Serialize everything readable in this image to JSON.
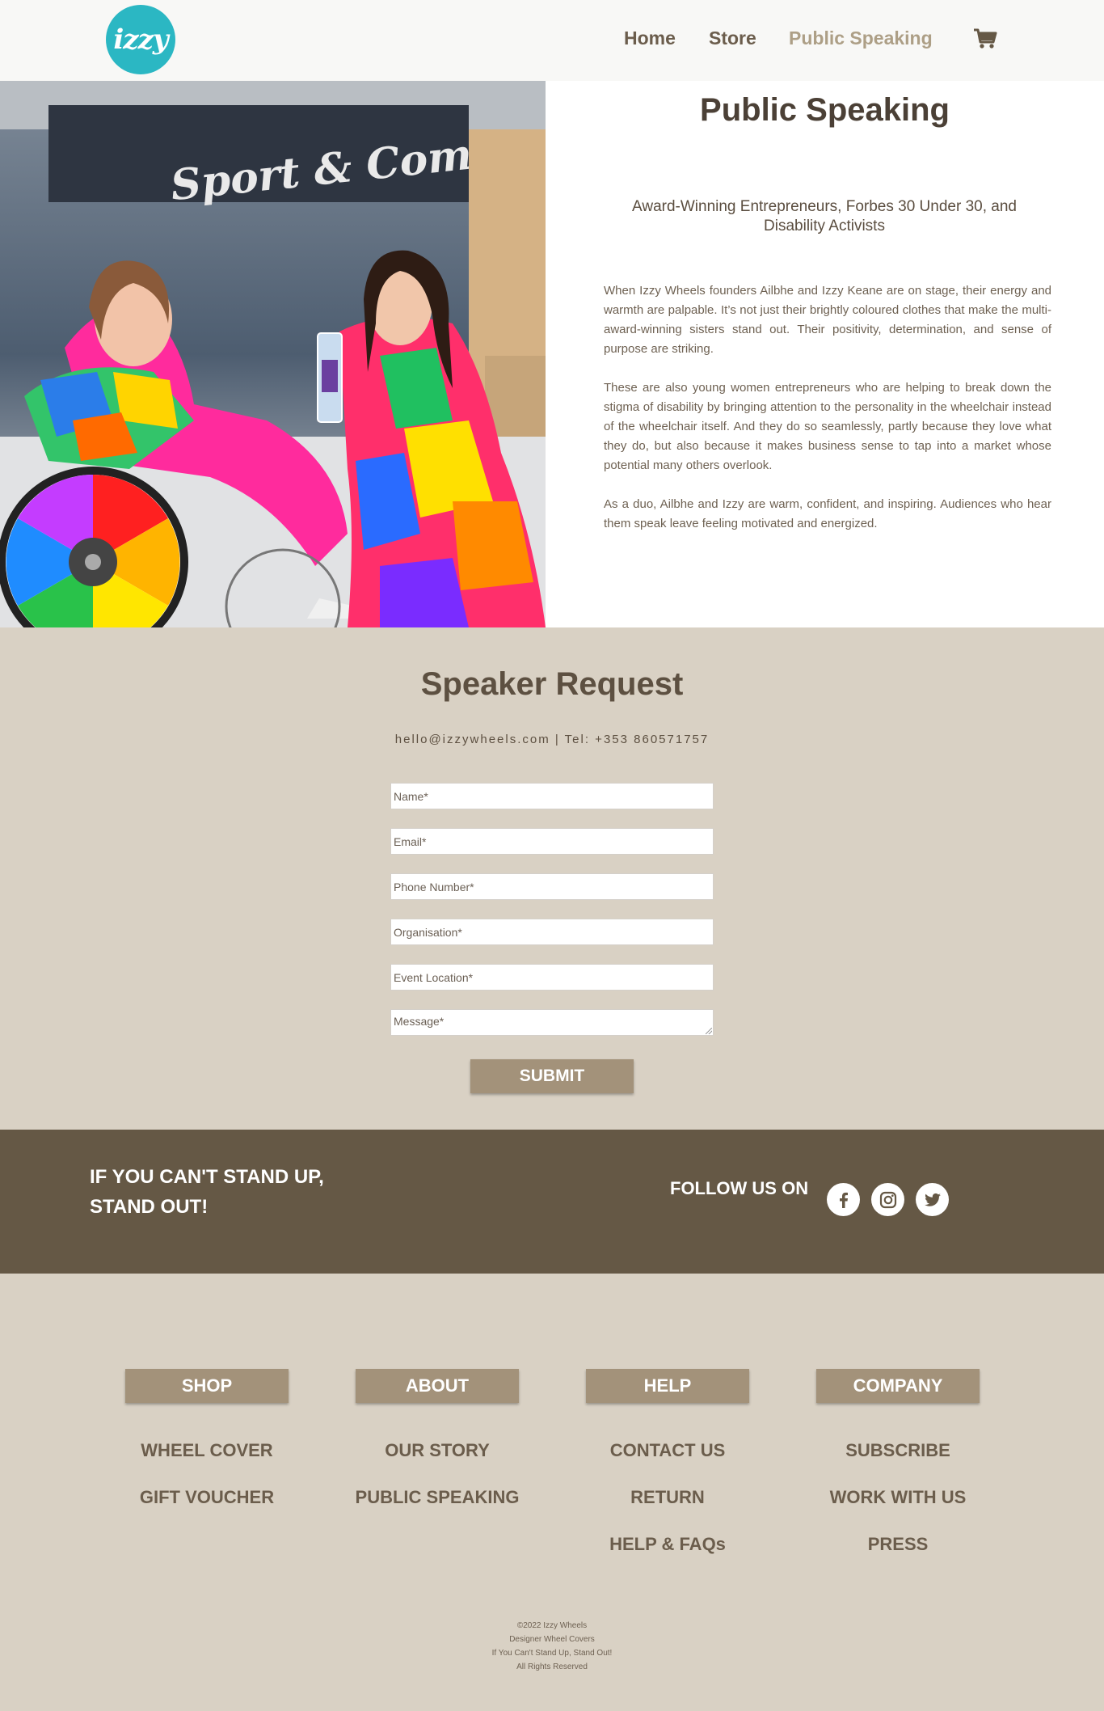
{
  "header": {
    "logo_text": "izzy",
    "nav": [
      "Home",
      "Store",
      "Public Speaking"
    ],
    "active_nav": "Public Speaking"
  },
  "hero": {
    "image_sign_text": "Sport & Competition",
    "title": "Public Speaking",
    "subtitle": "Award-Winning Entrepreneurs, Forbes 30 Under 30, and Disability Activists",
    "paragraphs": [
      "When Izzy Wheels founders Ailbhe and Izzy Keane are on stage, their energy and warmth are palpable. It’s not just their brightly coloured clothes that make the multi-award-winning sisters stand out. Their positivity, determination, and sense of purpose are striking.",
      "These are also young women entrepreneurs who are helping to break down the stigma of disability by bringing attention to the personality in the wheelchair instead of the wheelchair itself. And they do so seamlessly, partly because they love what they do, but also because it makes business sense to tap into a market whose potential many others overlook.",
      "As a duo, Ailbhe and Izzy are warm, confident, and inspiring. Audiences who hear them speak leave feeling motivated and energized."
    ]
  },
  "speaker_request": {
    "title": "Speaker Request",
    "contact": "hello@izzywheels.com  |  Tel: +353 860571757",
    "fields": [
      "Name*",
      "Email*",
      "Phone Number*",
      "Organisation*",
      "Event Location*",
      "Message*"
    ],
    "submit_label": "SUBMIT"
  },
  "band": {
    "slogan_line1": "IF YOU CAN'T STAND UP,",
    "slogan_line2": "STAND OUT!",
    "follow_label": "FOLLOW US ON",
    "social_icons": [
      "facebook-icon",
      "instagram-icon",
      "twitter-icon"
    ]
  },
  "footer": {
    "columns": [
      {
        "heading": "SHOP",
        "links": [
          "WHEEL COVER",
          "GIFT VOUCHER"
        ]
      },
      {
        "heading": "ABOUT",
        "links": [
          "OUR STORY",
          "PUBLIC SPEAKING"
        ]
      },
      {
        "heading": "HELP",
        "links": [
          "CONTACT US",
          "RETURN",
          "HELP & FAQs"
        ]
      },
      {
        "heading": "COMPANY",
        "links": [
          "SUBSCRIBE",
          "WORK WITH US",
          "PRESS"
        ]
      }
    ],
    "copyright": [
      "©2022 Izzy Wheels",
      "Designer Wheel Covers",
      "If You Can't Stand Up, Stand Out!",
      "All Rights Reserved"
    ]
  },
  "colors": {
    "accent_teal": "#2bb7c3",
    "beige_bg": "#d9d1c4",
    "band_brown": "#655845",
    "button_tan": "#a3927a",
    "nav_active": "#ad9f86"
  }
}
